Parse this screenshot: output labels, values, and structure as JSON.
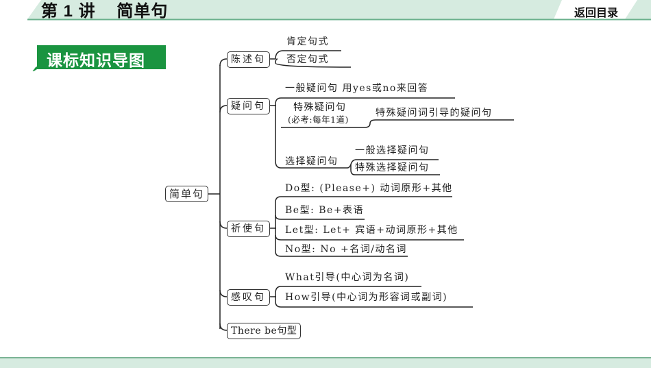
{
  "header": {
    "lesson_title": "第 1 讲    简单句",
    "back_button": "返回目录",
    "band_color": "#d6ebe0",
    "line_color": "#6ab08c"
  },
  "section": {
    "label": "课标知识导图",
    "color": "#1a9440"
  },
  "mindmap": {
    "root": "简单句",
    "branches": [
      {
        "label": "陈述句",
        "children": [
          "肯定句式",
          "否定句式"
        ]
      },
      {
        "label": "疑问句",
        "children": [
          {
            "label": "一般疑问句  用yes或no来回答"
          },
          {
            "label": "特殊疑问句",
            "note": "(必考:每年1道)",
            "children": [
              "特殊疑问词引导的疑问句"
            ]
          },
          {
            "label": "选择疑问句",
            "children": [
              "一般选择疑问句",
              "特殊选择疑问句"
            ]
          }
        ]
      },
      {
        "label": "祈使句",
        "children": [
          "Do型: (Please+) 动词原形+其他",
          "Be型: Be+表语",
          "Let型: Let+ 宾语+动词原形+其他",
          "No型: No +名词/动名词"
        ]
      },
      {
        "label": "感叹句",
        "children": [
          "What引导(中心词为名词)",
          "How引导(中心词为形容词或副词)"
        ]
      },
      {
        "label": "There be句型"
      }
    ]
  },
  "footer": {
    "color": "#d6ebe0"
  }
}
